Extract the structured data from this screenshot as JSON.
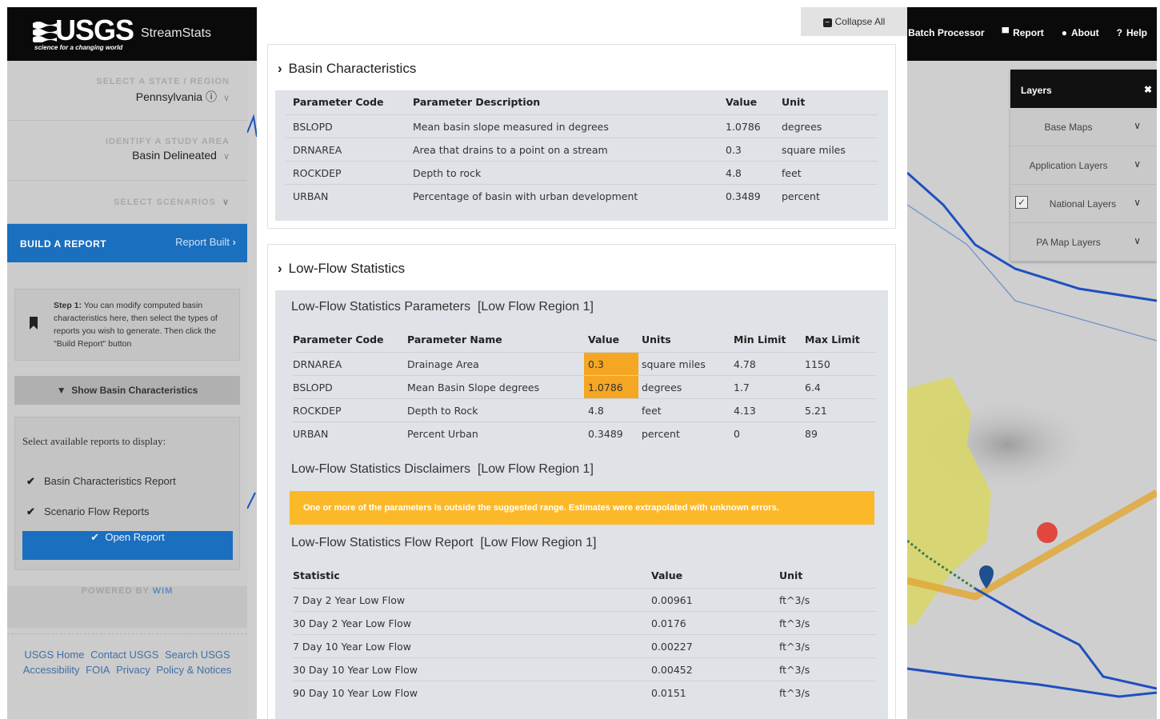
{
  "header": {
    "logo_text": "USGS",
    "logo_tagline": "science for a changing world",
    "app_name": "StreamStats",
    "nav": [
      {
        "icon": "batch-icon",
        "label": "Batch Processor"
      },
      {
        "icon": "book-icon",
        "label": "Report"
      },
      {
        "icon": "info-icon",
        "label": "About"
      },
      {
        "icon": "question-icon",
        "label": "Help"
      }
    ]
  },
  "sidebar": {
    "state_label": "SELECT A STATE / REGION",
    "state_value": "Pennsylvania",
    "study_label": "IDENTIFY A STUDY AREA",
    "study_value": "Basin Delineated",
    "scenarios_label": "SELECT SCENARIOS",
    "build_label": "BUILD A REPORT",
    "build_status": "Report Built",
    "step_bold": "Step 1:",
    "step_text": " You can modify computed basin characteristics here, then select the types of reports you wish to generate. Then click the \"Build Report\" button",
    "show_basin_label": "Show Basin Characteristics",
    "reports_title": "Select available reports to display:",
    "reports": [
      "Basin Characteristics Report",
      "Scenario Flow Reports"
    ],
    "open_report_label": "Open Report",
    "powered_by": "POWERED BY",
    "powered_brand": "WIM",
    "footer_links": [
      "USGS Home",
      "Contact USGS",
      "Search USGS",
      "Accessibility",
      "FOIA",
      "Privacy",
      "Policy & Notices"
    ]
  },
  "layers_panel": {
    "title": "Layers",
    "items": [
      {
        "label": "Base Maps",
        "checked": false
      },
      {
        "label": "Application Layers",
        "checked": false
      },
      {
        "label": "National Layers",
        "checked": true
      },
      {
        "label": "PA Map Layers",
        "checked": false
      }
    ]
  },
  "modal": {
    "collapse_label": "Collapse All",
    "basin": {
      "title": "Basin Characteristics",
      "headers": [
        "Parameter Code",
        "Parameter Description",
        "Value",
        "Unit"
      ],
      "rows": [
        [
          "BSLOPD",
          "Mean basin slope measured in degrees",
          "1.0786",
          "degrees"
        ],
        [
          "DRNAREA",
          "Area that drains to a point on a stream",
          "0.3",
          "square miles"
        ],
        [
          "ROCKDEP",
          "Depth to rock",
          "4.8",
          "feet"
        ],
        [
          "URBAN",
          "Percentage of basin with urban development",
          "0.3489",
          "percent"
        ]
      ]
    },
    "lowflow": {
      "title": "Low-Flow Statistics",
      "params_title": "Low-Flow Statistics Parameters",
      "region": "[Low Flow Region 1]",
      "params_headers": [
        "Parameter Code",
        "Parameter Name",
        "Value",
        "Units",
        "Min Limit",
        "Max Limit"
      ],
      "params_rows": [
        {
          "cells": [
            "DRNAREA",
            "Drainage Area",
            "0.3",
            "square miles",
            "4.78",
            "1150"
          ],
          "out_of_range": true
        },
        {
          "cells": [
            "BSLOPD",
            "Mean Basin Slope degrees",
            "1.0786",
            "degrees",
            "1.7",
            "6.4"
          ],
          "out_of_range": true
        },
        {
          "cells": [
            "ROCKDEP",
            "Depth to Rock",
            "4.8",
            "feet",
            "4.13",
            "5.21"
          ],
          "out_of_range": false
        },
        {
          "cells": [
            "URBAN",
            "Percent Urban",
            "0.3489",
            "percent",
            "0",
            "89"
          ],
          "out_of_range": false
        }
      ],
      "disclaimers_title": "Low-Flow Statistics Disclaimers",
      "warning": "One or more of the parameters is outside the suggested range. Estimates were extrapolated with unknown errors.",
      "flow_title": "Low-Flow Statistics Flow Report",
      "flow_headers": [
        "Statistic",
        "Value",
        "Unit"
      ],
      "flow_rows": [
        [
          "7 Day 2 Year Low Flow",
          "0.00961",
          "ft^3/s"
        ],
        [
          "30 Day 2 Year Low Flow",
          "0.0176",
          "ft^3/s"
        ],
        [
          "7 Day 10 Year Low Flow",
          "0.00227",
          "ft^3/s"
        ],
        [
          "30 Day 10 Year Low Flow",
          "0.00452",
          "ft^3/s"
        ],
        [
          "90 Day 10 Year Low Flow",
          "0.0151",
          "ft^3/s"
        ]
      ]
    }
  },
  "colors": {
    "header_bg": "#0a0a0a",
    "accent_blue": "#1a6fbf",
    "highlight_orange": "#f5a623",
    "warning_yellow": "#fbb92a",
    "basin_fill": "#d8d56a",
    "stream_blue": "#1f4fbf"
  }
}
